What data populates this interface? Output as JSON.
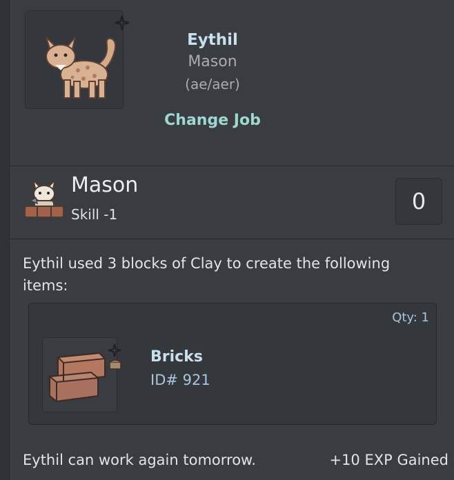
{
  "profile": {
    "name": "Eythil",
    "job": "Mason",
    "pronouns": "(ae/aer)",
    "change_job_label": "Change Job"
  },
  "job": {
    "title": "Mason",
    "skill": "Skill -1",
    "count": "0"
  },
  "result": {
    "message": "Eythil used 3 blocks of Clay to create the following items:",
    "item": {
      "qty": "Qty: 1",
      "name": "Bricks",
      "id": "ID# 921"
    }
  },
  "footer": {
    "cooldown": "Eythil can work again tomorrow.",
    "exp": "+10 EXP Gained"
  },
  "colors": {
    "accent_link": "#9dd8d1",
    "name_color": "#c8dfee"
  },
  "icons": {
    "pet": "cat-pet-icon",
    "job": "mason-job-icon",
    "item": "bricks-item-icon"
  }
}
